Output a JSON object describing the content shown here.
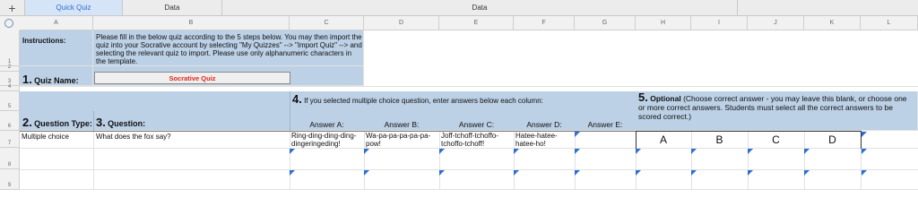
{
  "tabs": [
    {
      "label": "Quick Quiz",
      "active": true
    },
    {
      "label": "Data",
      "active": false
    },
    {
      "label": "Data",
      "active": false
    }
  ],
  "add_tab_symbol": "+",
  "columns": [
    "A",
    "B",
    "C",
    "D",
    "E",
    "F",
    "G",
    "H",
    "I",
    "J",
    "K",
    "L"
  ],
  "rows": [
    "1",
    "2",
    "3",
    "4",
    "5",
    "6",
    "7",
    "8",
    "9"
  ],
  "instructions": {
    "label": "Instructions:",
    "text": "Please fill in the below quiz according to the 5 steps below. You may then import the quiz into your Socrative account by selecting \"My Quizzes\" --> \"Import Quiz\" --> and selecting the relevant quiz to import. Please use only alphanumeric characters in the template."
  },
  "step1": {
    "number": "1.",
    "label": "Quiz Name:",
    "value": "Socrative Quiz"
  },
  "step2": {
    "number": "2.",
    "label": "Question Type:"
  },
  "step3": {
    "number": "3.",
    "label": "Question:"
  },
  "step4": {
    "number": "4.",
    "label": "If you selected multiple choice question, enter answers below each column:"
  },
  "step5": {
    "number": "5.",
    "label_bold": "Optional",
    "label": "(Choose correct answer - you may leave this blank, or choose one or more correct answers.  Students must select all the correct answers to be scored correct.)"
  },
  "answer_headers": [
    "Answer A:",
    "Answer B:",
    "Answer C:",
    "Answer D:",
    "Answer E:"
  ],
  "question_row": {
    "type": "Multiple choice",
    "question": "What does the fox say?",
    "answers": [
      "Ring-ding-ding-ding-dingeringeding!",
      "Wa-pa-pa-pa-pa-pa-pow!",
      "Joff-tchoff-tchoffo-tchoffo-tchoff!",
      "Hatee-hatee-hatee-ho!",
      ""
    ]
  },
  "correct_letters": [
    "A",
    "B",
    "C",
    "D"
  ],
  "colors": {
    "header_blue": "#bcd0e6",
    "accent": "#2a6fd1",
    "quiz_name_red": "#e0271f"
  }
}
